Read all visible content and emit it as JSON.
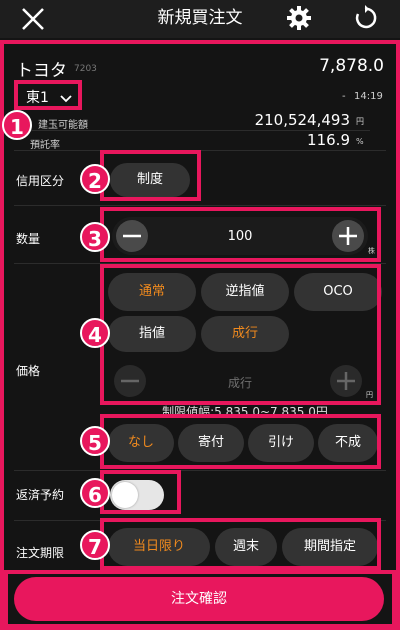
{
  "header": {
    "title": "新規買注文"
  },
  "stock": {
    "name": "トヨタ",
    "code": "7203",
    "price": "7,878.0",
    "market": "東1",
    "change": "-",
    "time": "14:19"
  },
  "account": {
    "buying_power_label": "建玉可能額",
    "buying_power_value": "210,524,493",
    "buying_power_unit": "円",
    "margin_rate_label": "預託率",
    "margin_rate_value": "116.9",
    "margin_rate_unit": "%"
  },
  "credit": {
    "label": "信用区分",
    "value": "制度"
  },
  "quantity": {
    "label": "数量",
    "value": "100",
    "unit": "株"
  },
  "price_section": {
    "label": "価格",
    "types": [
      "通常",
      "逆指値",
      "OCO"
    ],
    "modes": [
      "指値",
      "成行"
    ],
    "input_value": "成行",
    "unit": "円",
    "limit_text": "制限値幅:5,835.0~7,835.0円"
  },
  "conditions": [
    "なし",
    "寄付",
    "引け",
    "不成"
  ],
  "repayment": {
    "label": "返済予約"
  },
  "expiry": {
    "label": "注文期限",
    "options": [
      "当日限り",
      "週末",
      "期間指定"
    ]
  },
  "confirm": {
    "label": "注文確認"
  },
  "badges": [
    "1",
    "2",
    "3",
    "4",
    "5",
    "6",
    "7"
  ],
  "colors": {
    "accent": "#e8175d",
    "orange": "#f08a1e",
    "bg": "#141414"
  }
}
